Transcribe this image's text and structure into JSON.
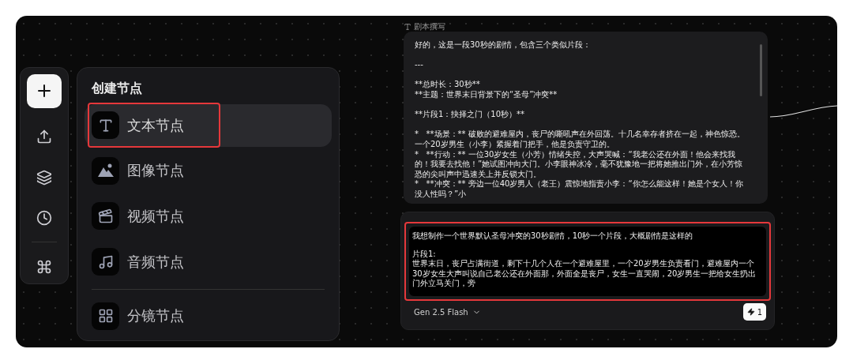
{
  "toolbar": {
    "items": [
      {
        "kind": "add",
        "selected": true
      },
      {
        "kind": "upload",
        "selected": false
      },
      {
        "kind": "layers",
        "selected": false
      },
      {
        "kind": "history",
        "selected": false
      },
      {
        "kind": "shortcuts",
        "selected": false
      }
    ]
  },
  "create_menu": {
    "title": "创建节点",
    "items": [
      {
        "kind": "text",
        "label": "文本节点",
        "selected": true,
        "annotated": true
      },
      {
        "kind": "image",
        "label": "图像节点",
        "selected": false,
        "annotated": false
      },
      {
        "kind": "video",
        "label": "视频节点",
        "selected": false,
        "annotated": false
      },
      {
        "kind": "audio",
        "label": "音频节点",
        "selected": false,
        "annotated": false
      },
      {
        "kind": "storyboard",
        "label": "分镜节点",
        "selected": false,
        "annotated": false
      }
    ]
  },
  "script_node": {
    "title": "剧本撰写",
    "paragraphs": [
      "好的，这是一段30秒的剧情，包含三个类似片段：",
      "---",
      "**总时长：30秒**\n**主题：世界末日背景下的“圣母”冲突**",
      "**片段1：抉择之门（10秒）**",
      "*   **场景：** 破败的避难屋内，丧尸的嘶吼声在外回荡。十几名幸存者挤在一起，神色惊恐。一个20岁男生（小李）紧握着门把手，他是负责守卫的。\n*   **行动：** 一位30岁女生（小芳）情绪失控，大声哭喊：“我老公还在外面！他会来找我的！我要去找他！”她试图冲向大门。小李眼神冰冷，毫不犹豫地一把将她推出门外，在小芳惊恐的尖叫声中迅速关上并反锁大门。\n*   **冲突：** 旁边一位40岁男人（老王）震惊地指责小李：“你怎么能这样！她是个女人！你没人性吗？”小"
    ]
  },
  "prompt_panel": {
    "annotated": true,
    "paragraphs": [
      "我想制作一个世界默认圣母冲突的30秒剧情，10秒一个片段，大概剧情是这样的",
      "片段1:\n世界末日，丧尸占满街道，剩下十几个人在一个避难屋里，一个20岁男生负责看门，避难屋内一个30岁女生大声叫说自己老公还在外面那，外面全是丧尸，女生一直哭闹，20岁男生一把给女生扔出门外立马关门，旁"
    ],
    "model": "Gen 2.5 Flash",
    "credits": "1"
  }
}
